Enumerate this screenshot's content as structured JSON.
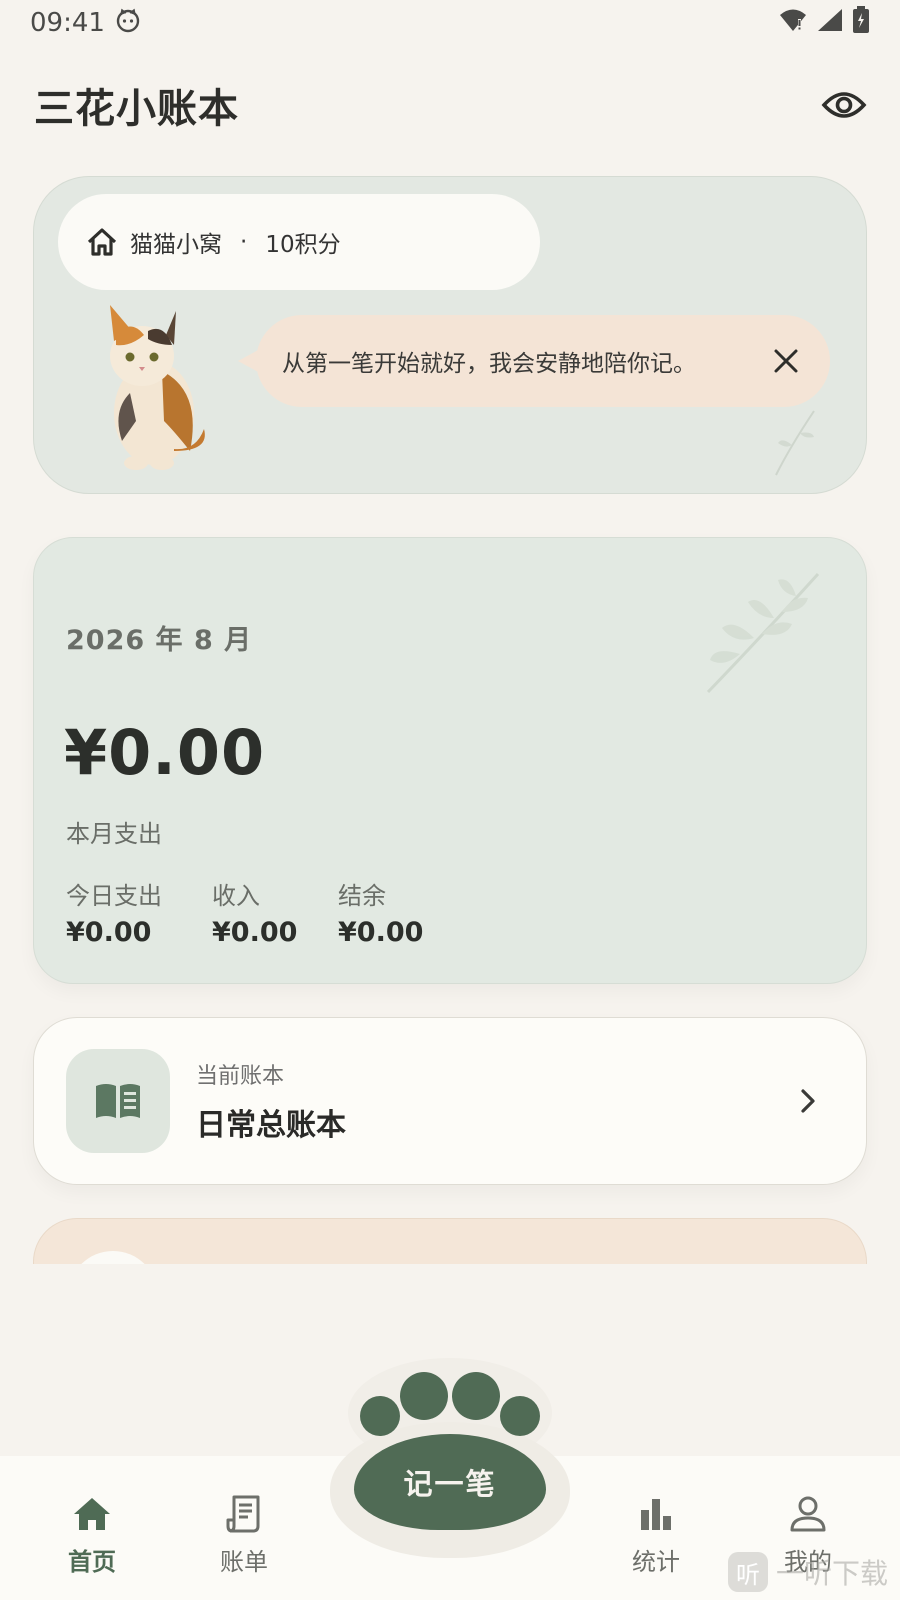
{
  "status_bar": {
    "time": "09:41"
  },
  "header": {
    "title": "三花小账本"
  },
  "cat_card": {
    "nest_name": "猫猫小窝",
    "separator": "·",
    "points": "10积分",
    "speech": "从第一笔开始就好，我会安静地陪你记。"
  },
  "month_card": {
    "period": "2026 年 8 月",
    "amount": "¥0.00",
    "caption": "本月支出",
    "stats": [
      {
        "label": "今日支出",
        "value": "¥0.00"
      },
      {
        "label": "收入",
        "value": "¥0.00"
      },
      {
        "label": "结余",
        "value": "¥0.00"
      }
    ]
  },
  "ledger_card": {
    "subtitle": "当前账本",
    "name": "日常总账本"
  },
  "bottom_nav": {
    "items": [
      {
        "label": "首页",
        "icon": "home-icon"
      },
      {
        "label": "账单",
        "icon": "receipt-icon"
      },
      {
        "label": "统计",
        "icon": "bar-chart-icon"
      },
      {
        "label": "我的",
        "icon": "user-icon"
      }
    ],
    "record_button": "记一笔"
  },
  "watermark": {
    "badge": "听",
    "text": "一听下载"
  },
  "colors": {
    "background": "#f6f3ee",
    "accent": "#506b55",
    "sage_card": "#e2e9e2",
    "peach": "#f4e4d6"
  }
}
